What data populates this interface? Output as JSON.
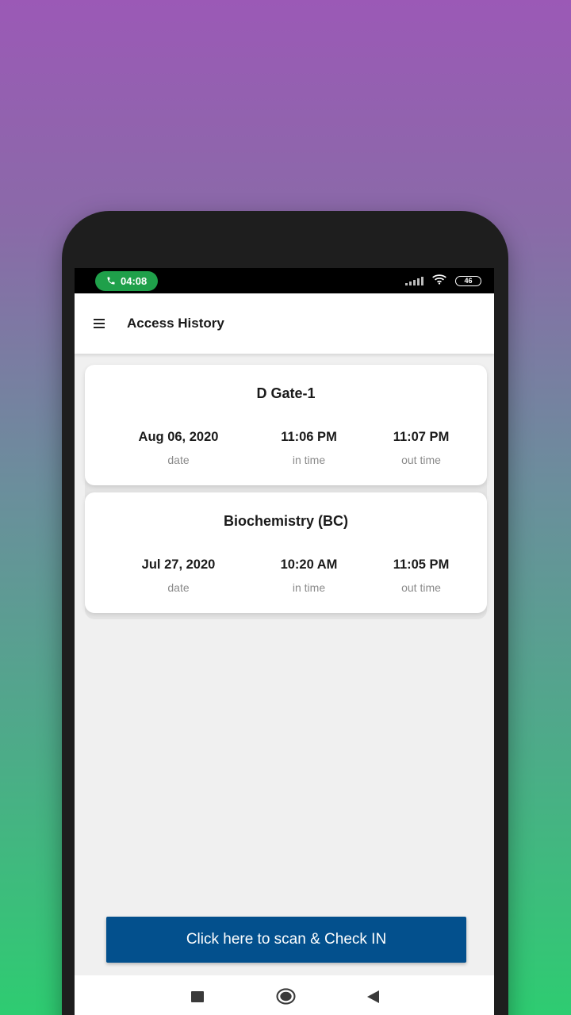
{
  "status_bar": {
    "call_time": "04:08",
    "battery_level": "46",
    "call_icon": "phone-icon",
    "signal_icon": "signal-icon",
    "wifi_icon": "wifi-icon"
  },
  "app_bar": {
    "title": "Access History",
    "menu_icon": "hamburger-menu-icon"
  },
  "records": [
    {
      "location": "D Gate-1",
      "date": "Aug 06, 2020",
      "date_label": "date",
      "in_time": "11:06 PM",
      "in_label": "in time",
      "out_time": "11:07 PM",
      "out_label": "out time"
    },
    {
      "location": "Biochemistry (BC)",
      "date": "Jul 27, 2020",
      "date_label": "date",
      "in_time": "10:20 AM",
      "in_label": "in time",
      "out_time": "11:05 PM",
      "out_label": "out time"
    }
  ],
  "scan_button": {
    "label": "Click here to scan & Check IN"
  },
  "nav_bar": {
    "recents_icon": "square-recents-icon",
    "home_icon": "circle-home-icon",
    "back_icon": "triangle-back-icon"
  },
  "colors": {
    "primary_button": "#03508d",
    "call_pill": "#1fa04a",
    "gradient_top": "#9b59b6",
    "gradient_bottom": "#2ecc71"
  }
}
